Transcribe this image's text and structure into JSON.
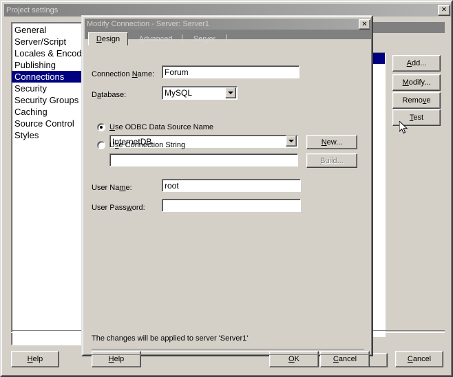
{
  "main_window": {
    "title": "Project settings",
    "close_label": "✕",
    "sidebar": {
      "items": [
        {
          "label": "General",
          "selected": false
        },
        {
          "label": "Server/Script",
          "selected": false
        },
        {
          "label": "Locales & Encod",
          "selected": false
        },
        {
          "label": "Publishing",
          "selected": false
        },
        {
          "label": "Connections",
          "selected": true
        },
        {
          "label": "Security",
          "selected": false
        },
        {
          "label": "Security Groups",
          "selected": false
        },
        {
          "label": "Caching",
          "selected": false
        },
        {
          "label": "Source Control",
          "selected": false
        },
        {
          "label": "Styles",
          "selected": false
        }
      ]
    },
    "side_buttons": [
      {
        "label": "Add...",
        "accel": "A"
      },
      {
        "label": "Modify...",
        "accel": "M"
      },
      {
        "label": "Remove",
        "accel": "v"
      },
      {
        "label": "Test",
        "accel": "T"
      }
    ],
    "footer": {
      "help_label": "Help",
      "cancel_label": "Cancel"
    }
  },
  "dialog": {
    "title": "Modify Connection - Server: Server1",
    "close_label": "✕",
    "tabs": [
      {
        "label": "Design",
        "active": true
      },
      {
        "label": "Advanced",
        "active": false
      },
      {
        "label": "Server",
        "active": false
      }
    ],
    "fields": {
      "connection_name_label": "Connection Name:",
      "connection_name_value": "Forum",
      "database_label": "Database:",
      "database_value": "MySQL",
      "odbc_radio_label": "Use ODBC Data Source Name",
      "odbc_radio_selected": true,
      "odbc_dsn_value": "InternetDB",
      "connstring_radio_label": "Use Connection String",
      "connstring_radio_selected": false,
      "connstring_value": "",
      "user_name_label": "User Name:",
      "user_name_value": "root",
      "user_password_label": "User Password:",
      "user_password_value": ""
    },
    "buttons": {
      "new_label": "New...",
      "build_label": "Build...",
      "build_disabled": true,
      "help_label": "Help",
      "ok_label": "OK",
      "cancel_label": "Cancel"
    },
    "status_note": "The changes will be applied to server 'Server1'"
  },
  "colors": {
    "face": "#d4d0c8",
    "selection": "#000080",
    "title_gradient_start": "#808080",
    "title_gradient_end": "#b5b5b5",
    "strip": "#808080",
    "disabled_text": "#808080"
  }
}
